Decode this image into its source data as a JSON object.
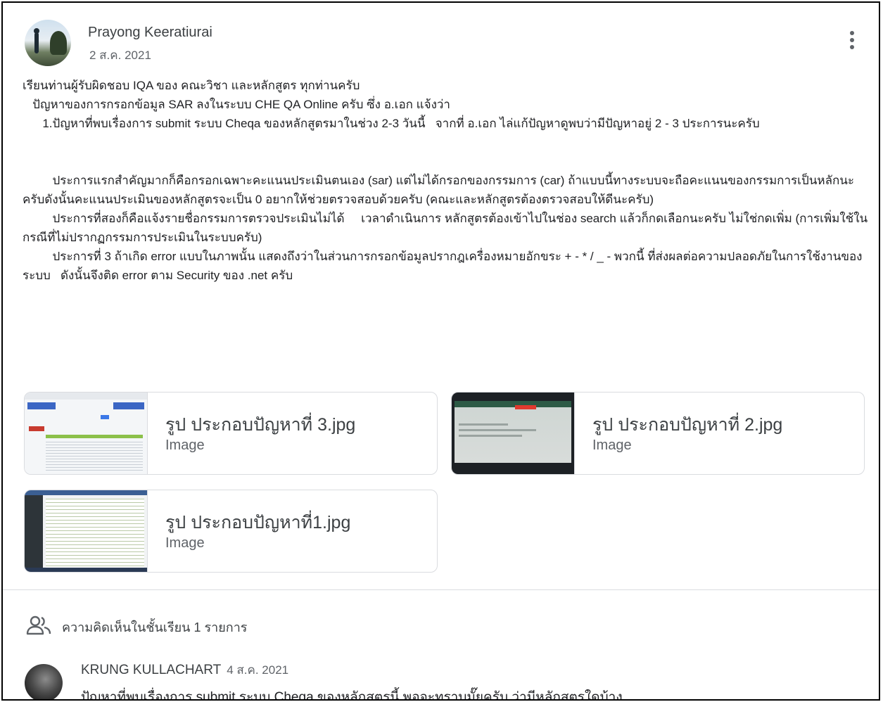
{
  "post": {
    "author": "Prayong Keeratiurai",
    "date": "2 ส.ค. 2021",
    "paragraphs": [
      "เรียนท่านผู้รับผิดชอบ IQA ของ คณะวิชา และหลักสูตร ทุกท่านครับ",
      "   ปัญหาของการกรอกข้อมูล SAR ลงในระบบ CHE QA Online ครับ ซึ่ง อ.เอก แจ้งว่า",
      "      1.ปัญหาที่พบเรื่องการ submit ระบบ Cheqa ของหลักสูตรมาในช่วง 2-3 วันนี้   จากที่ อ.เอก ไล่แก้ปัญหาดูพบว่ามีปัญหาอยู่ 2 - 3 ประการนะครับ",
      "",
      "",
      "         ประการแรกสำคัญมากก็คือกรอกเฉพาะคะแนนประเมินตนเอง (sar) แต่ไม่ได้กรอกของกรรมการ (car) ถ้าแบบนี้ทางระบบจะถือคะแนนของกรรมการเป็นหลักนะครับดังนั้นคะแนนประเมินของหลักสูตรจะเป็น 0 อยากให้ช่วยตรวจสอบด้วยครับ (คณะและหลักสูตรต้องตรวจสอบให้ดีนะครับ)",
      "         ประการที่สองก็คือแจ้งรายชื่อกรรมการตรวจประเมินไม่ได้     เวลาดำเนินการ หลักสูตรต้องเข้าไปในช่อง search แล้วก็กดเลือกนะครับ ไม่ใช่กดเพิ่ม (การเพิ่มใช้ในกรณีที่ไม่ปรากฏกรรมการประเมินในระบบครับ)",
      "         ประการที่ 3 ถ้าเกิด error แบบในภาพนั้น แสดงถึงว่าในส่วนการกรอกข้อมูลปรากฎเครื่องหมายอักขระ + - * / _ - พวกนี้ ที่ส่งผลต่อความปลอดภัยในการใช้งานของระบบ   ดังนั้นจึงติด error ตาม Security ของ .net ครับ"
    ]
  },
  "attachments": [
    {
      "title": "รูป ประกอบปัญหาที่ 3.jpg",
      "type": "Image"
    },
    {
      "title": "รูป ประกอบปัญหาที่ 2.jpg",
      "type": "Image"
    },
    {
      "title": "รูป ประกอบปัญหาที่1.jpg",
      "type": "Image"
    }
  ],
  "comments": {
    "label": "ความคิดเห็นในชั้นเรียน 1 รายการ",
    "items": [
      {
        "author": "KRUNG KULLACHART",
        "date": "4 ส.ค. 2021",
        "text": "ปัญหาที่พบเรื่องการ submit ระบบ Cheqa ของหลักสูตรนี้ พอจะทราบมั๊ยครับ ว่ามีหลักสูตรใดบ้าง"
      }
    ]
  }
}
